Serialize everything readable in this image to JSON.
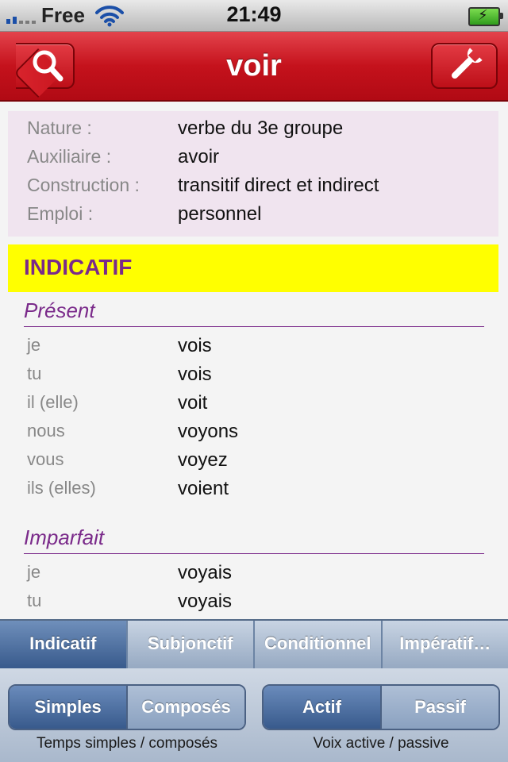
{
  "status_bar": {
    "carrier": "Free",
    "time": "21:49",
    "signal_bars_on": 2,
    "battery_charging": true
  },
  "navbar": {
    "title": "voir",
    "left_icon": "search-icon",
    "right_icon": "wrench-icon"
  },
  "info": [
    {
      "key": "Nature :",
      "value": "verbe du 3e groupe"
    },
    {
      "key": "Auxiliaire :",
      "value": "avoir"
    },
    {
      "key": "Construction :",
      "value": "transitif direct et indirect"
    },
    {
      "key": "Emploi :",
      "value": "personnel"
    }
  ],
  "mood": {
    "label": "INDICATIF",
    "color": "#ffff00"
  },
  "tenses": [
    {
      "name": "Présent",
      "rows": [
        {
          "pronoun": "je",
          "form": "vois"
        },
        {
          "pronoun": "tu",
          "form": "vois"
        },
        {
          "pronoun": "il (elle)",
          "form": "voit"
        },
        {
          "pronoun": "nous",
          "form": "voyons"
        },
        {
          "pronoun": "vous",
          "form": "voyez"
        },
        {
          "pronoun": "ils (elles)",
          "form": "voient"
        }
      ]
    },
    {
      "name": "Imparfait",
      "rows": [
        {
          "pronoun": "je",
          "form": "voyais"
        },
        {
          "pronoun": "tu",
          "form": "voyais"
        }
      ]
    }
  ],
  "tabs": [
    {
      "label": "Indicatif",
      "active": true
    },
    {
      "label": "Subjonctif",
      "active": false
    },
    {
      "label": "Conditionnel",
      "active": false
    },
    {
      "label": "Impératif…",
      "active": false
    }
  ],
  "segments": {
    "tense_type": {
      "options": [
        "Simples",
        "Composés"
      ],
      "selected": "Simples",
      "caption": "Temps simples / composés"
    },
    "voice": {
      "options": [
        "Actif",
        "Passif"
      ],
      "selected": "Actif",
      "caption": "Voix active / passive"
    }
  },
  "colors": {
    "accent_red": "#c5121c",
    "purple": "#7a2a8a",
    "info_bg": "#f0e4ef",
    "tab_active": "#385a8c"
  }
}
